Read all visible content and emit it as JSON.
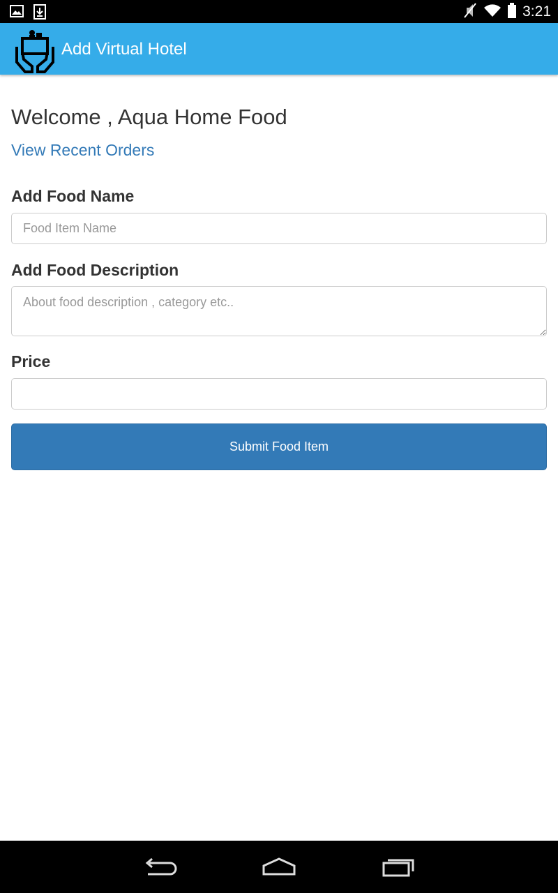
{
  "status_bar": {
    "time": "3:21",
    "icons": [
      "gallery-icon",
      "download-icon",
      "mute-icon",
      "wifi-icon",
      "battery-icon"
    ]
  },
  "app_bar": {
    "title": "Add Virtual Hotel",
    "logo": "hotel-service-logo",
    "color": "#35ace9"
  },
  "main": {
    "welcome": "Welcome , Aqua Home Food",
    "recent_orders_link": "View Recent Orders",
    "food_name": {
      "label": "Add Food Name",
      "placeholder": "Food Item Name",
      "value": ""
    },
    "food_description": {
      "label": "Add Food Description",
      "placeholder": "About food description , category etc..",
      "value": ""
    },
    "price": {
      "label": "Price",
      "placeholder": "",
      "value": ""
    },
    "submit_label": "Submit Food Item",
    "accent_color": "#337ab7",
    "link_color": "#337ab7"
  },
  "nav_bar": {
    "buttons": [
      "back-icon",
      "home-icon",
      "recent-apps-icon"
    ]
  }
}
